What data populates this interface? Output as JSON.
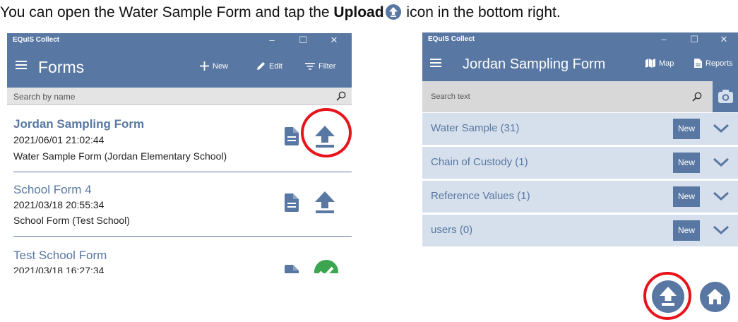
{
  "caption": {
    "before": "You can open the Water Sample Form and tap the ",
    "bold": "Upload",
    "after": " icon in the bottom right."
  },
  "left_window": {
    "title": "EQuIS Collect",
    "controls": {
      "minimize": "–",
      "maximize": "☐",
      "close": "✕"
    },
    "app_title": "Forms",
    "actions": {
      "new": "New",
      "edit": "Edit",
      "filter": "Filter"
    },
    "search_placeholder": "Search by name",
    "forms": [
      {
        "name": "Jordan Sampling Form",
        "date": "2021/06/01 21:02:44",
        "desc": "Water Sample Form (Jordan Elementary School)",
        "status": "upload"
      },
      {
        "name": "School Form 4",
        "date": "2021/03/18 20:55:34",
        "desc": "School Form (Test School)",
        "status": "upload"
      },
      {
        "name": "Test School Form",
        "date": "2021/03/18 16:27:34",
        "status": "uploaded"
      }
    ]
  },
  "right_window": {
    "title": "EQuIS Collect",
    "controls": {
      "minimize": "–",
      "maximize": "☐",
      "close": "✕"
    },
    "app_title": "Jordan Sampling Form",
    "actions": {
      "map": "Map",
      "reports": "Reports"
    },
    "search_placeholder": "Search text",
    "sections": [
      {
        "label": "Water Sample (31)",
        "new": "New"
      },
      {
        "label": "Chain of Custody (1)",
        "new": "New"
      },
      {
        "label": "Reference Values (1)",
        "new": "New"
      },
      {
        "label": "users (0)",
        "new": "New"
      }
    ]
  },
  "colors": {
    "accent": "#5877a2",
    "section_bg": "#d6e0ec",
    "highlight": "#e8141b",
    "success": "#3aa64f"
  },
  "icons": [
    "hamburger-icon",
    "plus-icon",
    "pencil-icon",
    "filter-icon",
    "search-icon",
    "document-icon",
    "upload-icon",
    "checkmark-icon",
    "map-icon",
    "reports-icon",
    "camera-icon",
    "chevron-down-icon",
    "home-icon"
  ]
}
